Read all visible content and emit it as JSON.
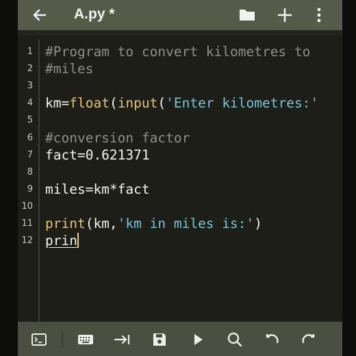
{
  "toolbar": {
    "title": "A.py *",
    "icons": [
      "back-arrow-icon",
      "folder-icon",
      "plus-icon",
      "more-vert-icon"
    ]
  },
  "editor": {
    "lines": [
      {
        "n": "1",
        "tokens": [
          {
            "t": "#Program to convert kilometres to",
            "c": "cm"
          }
        ]
      },
      {
        "n": "2",
        "tokens": [
          {
            "t": "#miles",
            "c": "cm"
          }
        ]
      },
      {
        "n": "3",
        "tokens": []
      },
      {
        "n": "4",
        "tokens": [
          {
            "t": "km=",
            "c": ""
          },
          {
            "t": "float",
            "c": "kw"
          },
          {
            "t": "(",
            "c": ""
          },
          {
            "t": "input",
            "c": "kw"
          },
          {
            "t": "(",
            "c": ""
          },
          {
            "t": "'Enter kilometres:'",
            "c": "str"
          }
        ]
      },
      {
        "n": "5",
        "tokens": []
      },
      {
        "n": "6",
        "tokens": [
          {
            "t": "#conversion factor",
            "c": "cm"
          }
        ]
      },
      {
        "n": "7",
        "tokens": [
          {
            "t": "fact=0.621371",
            "c": ""
          }
        ]
      },
      {
        "n": "8",
        "tokens": []
      },
      {
        "n": "9",
        "tokens": [
          {
            "t": "miles=km*fact",
            "c": ""
          }
        ]
      },
      {
        "n": "10",
        "tokens": []
      },
      {
        "n": "11",
        "tokens": [
          {
            "t": "print",
            "c": "kw"
          },
          {
            "t": "(km,",
            "c": ""
          },
          {
            "t": "'km in miles is:'",
            "c": "str"
          },
          {
            "t": ")",
            "c": ""
          }
        ]
      },
      {
        "n": "12",
        "tokens": [
          {
            "t": "prin",
            "c": "cursor-text"
          }
        ]
      }
    ]
  },
  "bottom_bar": {
    "icons": [
      "terminal-icon",
      "keyboard-icon",
      "tab-indent-icon",
      "save-icon",
      "run-icon",
      "search-icon",
      "undo-icon",
      "redo-icon"
    ]
  },
  "colors": {
    "toolbar": "#565a4a",
    "editor_bg": "#1d1e17",
    "keyword": "#e3c472",
    "string": "#74c3d8",
    "comment": "#8e8f84",
    "bottom_bar": "#4b4f41"
  }
}
